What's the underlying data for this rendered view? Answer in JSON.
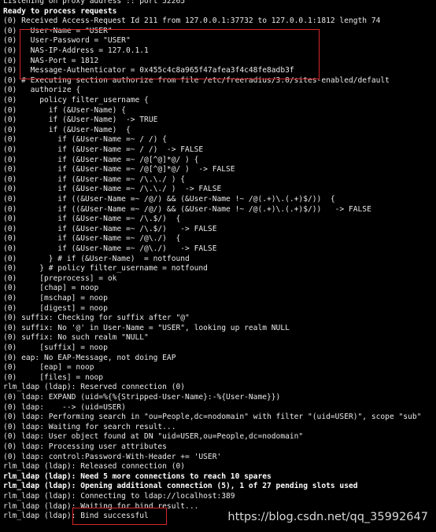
{
  "terminal": {
    "lines": [
      {
        "text": "Listening on proxy address :: port 52265",
        "bold": false
      },
      {
        "text": "Ready to process requests",
        "bold": true
      },
      {
        "text": "(0) Received Access-Request Id 211 from 127.0.0.1:37732 to 127.0.0.1:1812 length 74",
        "bold": false
      },
      {
        "text": "(0)   User-Name = \"USER\"",
        "bold": false
      },
      {
        "text": "(0)   User-Password = \"USER\"",
        "bold": false
      },
      {
        "text": "(0)   NAS-IP-Address = 127.0.1.1",
        "bold": false
      },
      {
        "text": "(0)   NAS-Port = 1812",
        "bold": false
      },
      {
        "text": "(0)   Message-Authenticator = 0x455c4c8a965f47afea3f4c48fe8adb3f",
        "bold": false
      },
      {
        "text": "(0) # Executing section authorize from file /etc/freeradius/3.0/sites-enabled/default",
        "bold": false
      },
      {
        "text": "(0)   authorize {",
        "bold": false
      },
      {
        "text": "(0)     policy filter_username {",
        "bold": false
      },
      {
        "text": "(0)       if (&User-Name) {",
        "bold": false
      },
      {
        "text": "(0)       if (&User-Name)  -> TRUE",
        "bold": false
      },
      {
        "text": "(0)       if (&User-Name)  {",
        "bold": false
      },
      {
        "text": "(0)         if (&User-Name =~ / /) {",
        "bold": false
      },
      {
        "text": "(0)         if (&User-Name =~ / /)  -> FALSE",
        "bold": false
      },
      {
        "text": "(0)         if (&User-Name =~ /@[^@]*@/ ) {",
        "bold": false
      },
      {
        "text": "(0)         if (&User-Name =~ /@[^@]*@/ )  -> FALSE",
        "bold": false
      },
      {
        "text": "(0)         if (&User-Name =~ /\\.\\./ ) {",
        "bold": false
      },
      {
        "text": "(0)         if (&User-Name =~ /\\.\\./ )  -> FALSE",
        "bold": false
      },
      {
        "text": "(0)         if ((&User-Name =~ /@/) && (&User-Name !~ /@(.+)\\.(.+)$/))  {",
        "bold": false
      },
      {
        "text": "(0)         if ((&User-Name =~ /@/) && (&User-Name !~ /@(.+)\\.(.+)$/))   -> FALSE",
        "bold": false
      },
      {
        "text": "(0)         if (&User-Name =~ /\\.$/)  {",
        "bold": false
      },
      {
        "text": "(0)         if (&User-Name =~ /\\.$/)   -> FALSE",
        "bold": false
      },
      {
        "text": "(0)         if (&User-Name =~ /@\\./)  {",
        "bold": false
      },
      {
        "text": "(0)         if (&User-Name =~ /@\\./)   -> FALSE",
        "bold": false
      },
      {
        "text": "(0)       } # if (&User-Name)  = notfound",
        "bold": false
      },
      {
        "text": "(0)     } # policy filter_username = notfound",
        "bold": false
      },
      {
        "text": "(0)     [preprocess] = ok",
        "bold": false
      },
      {
        "text": "(0)     [chap] = noop",
        "bold": false
      },
      {
        "text": "(0)     [mschap] = noop",
        "bold": false
      },
      {
        "text": "(0)     [digest] = noop",
        "bold": false
      },
      {
        "text": "(0) suffix: Checking for suffix after \"@\"",
        "bold": false
      },
      {
        "text": "(0) suffix: No '@' in User-Name = \"USER\", looking up realm NULL",
        "bold": false
      },
      {
        "text": "(0) suffix: No such realm \"NULL\"",
        "bold": false
      },
      {
        "text": "(0)     [suffix] = noop",
        "bold": false
      },
      {
        "text": "(0) eap: No EAP-Message, not doing EAP",
        "bold": false
      },
      {
        "text": "(0)     [eap] = noop",
        "bold": false
      },
      {
        "text": "(0)     [files] = noop",
        "bold": false
      },
      {
        "text": "rlm_ldap (ldap): Reserved connection (0)",
        "bold": false
      },
      {
        "text": "(0) ldap: EXPAND (uid=%{%{Stripped-User-Name}:-%{User-Name}})",
        "bold": false
      },
      {
        "text": "(0) ldap:    --> (uid=USER)",
        "bold": false
      },
      {
        "text": "(0) ldap: Performing search in \"ou=People,dc=nodomain\" with filter \"(uid=USER)\", scope \"sub\"",
        "bold": false
      },
      {
        "text": "(0) ldap: Waiting for search result...",
        "bold": false
      },
      {
        "text": "(0) ldap: User object found at DN \"uid=USER,ou=People,dc=nodomain\"",
        "bold": false
      },
      {
        "text": "(0) ldap: Processing user attributes",
        "bold": false
      },
      {
        "text": "(0) ldap: control:Password-With-Header += 'USER'",
        "bold": false
      },
      {
        "text": "rlm_ldap (ldap): Released connection (0)",
        "bold": false
      },
      {
        "text": "rlm_ldap (ldap): Need 5 more connections to reach 10 spares",
        "bold": true
      },
      {
        "text": "rlm_ldap (ldap): Opening additional connection (5), 1 of 27 pending slots used",
        "bold": true
      },
      {
        "text": "rlm_ldap (ldap): Connecting to ldap://localhost:389",
        "bold": false
      },
      {
        "text": "rlm_ldap (ldap): Waiting for bind result...",
        "bold": false
      },
      {
        "text": "rlm_ldap (ldap): Bind successful",
        "bold": false
      }
    ]
  },
  "watermark": "https://blog.csdn.net/qq_35992647",
  "colors": {
    "background": "#000000",
    "text": "#e9e9e9",
    "highlight_box": "#d9262b"
  }
}
